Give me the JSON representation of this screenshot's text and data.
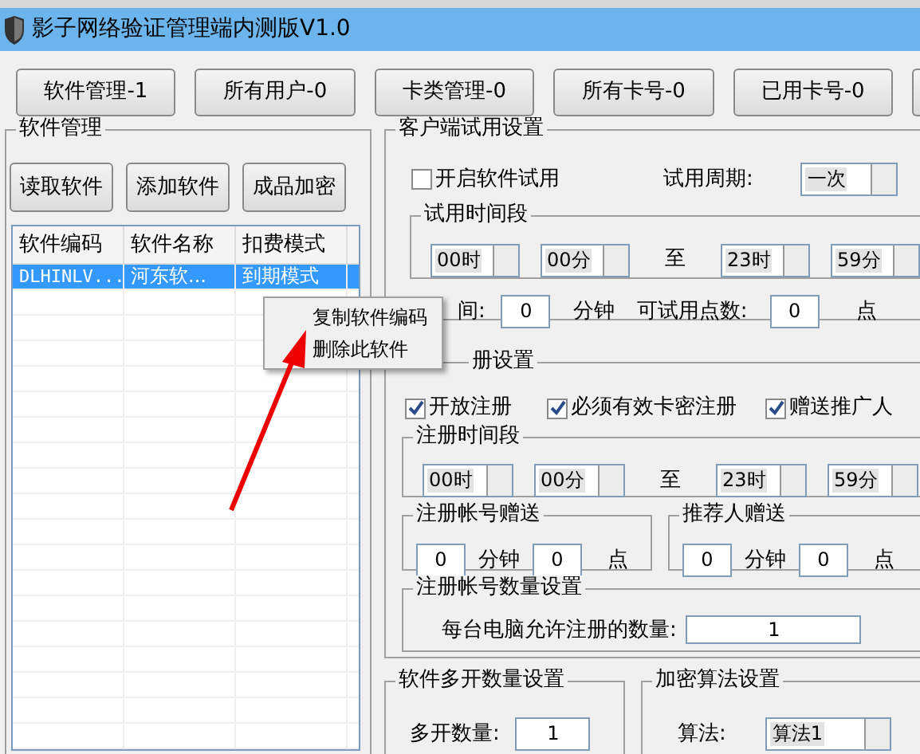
{
  "window": {
    "title": "影子网络验证管理端内测版V1.0"
  },
  "top_buttons": [
    "软件管理-1",
    "所有用户-0",
    "卡类管理-0",
    "所有卡号-0",
    "已用卡号-0"
  ],
  "software_panel": {
    "title": "软件管理",
    "buttons": [
      "读取软件",
      "添加软件",
      "成品加密"
    ],
    "table": {
      "columns": [
        "软件编码",
        "软件名称",
        "扣费模式"
      ],
      "rows": [
        {
          "cells": [
            "DLHINLV...",
            "河东软...",
            "到期模式"
          ],
          "selected": true
        }
      ]
    },
    "context_menu": [
      "复制软件编码",
      "删除此软件"
    ]
  },
  "trial": {
    "title": "客户端试用设置",
    "enable": {
      "label": "开启软件试用",
      "checked": false
    },
    "period_label": "试用周期:",
    "period": "一次",
    "range": {
      "title": "试用时间段",
      "fields": [
        {
          "kind": "combo",
          "value": "00时"
        },
        {
          "kind": "combo",
          "value": "00分"
        },
        {
          "kind": "text",
          "value": "至"
        },
        {
          "kind": "combo",
          "value": "23时"
        },
        {
          "kind": "combo",
          "value": "59分"
        }
      ]
    },
    "time_label": "间:",
    "time_value": "0",
    "time_unit": "分钟",
    "points_label": "可试用点数:",
    "points_value": "0",
    "points_unit": "点"
  },
  "register": {
    "title": "册设置",
    "options": [
      {
        "label": "开放注册",
        "checked": true
      },
      {
        "label": "必须有效卡密注册",
        "checked": true
      },
      {
        "label": "赠送推广人",
        "checked": true
      }
    ],
    "range": {
      "title": "注册时间段",
      "fields": [
        {
          "kind": "combo",
          "value": "00时"
        },
        {
          "kind": "combo",
          "value": "00分"
        },
        {
          "kind": "text",
          "value": "至"
        },
        {
          "kind": "combo",
          "value": "23时"
        },
        {
          "kind": "combo",
          "value": "59分"
        }
      ]
    },
    "gifts": [
      {
        "title": "注册帐号赠送",
        "minutes": "0",
        "minutes_unit": "分钟",
        "points": "0",
        "points_unit": "点"
      },
      {
        "title": "推荐人赠送",
        "minutes": "0",
        "minutes_unit": "分钟",
        "points": "0",
        "points_unit": "点"
      }
    ],
    "limit": {
      "title": "注册帐号数量设置",
      "label": "每台电脑允许注册的数量:",
      "value": "1"
    }
  },
  "multi_open": {
    "title": "软件多开数量设置",
    "label": "多开数量:",
    "value": "1"
  },
  "encryption": {
    "title": "加密算法设置",
    "label": "算法:",
    "value": "算法1"
  }
}
